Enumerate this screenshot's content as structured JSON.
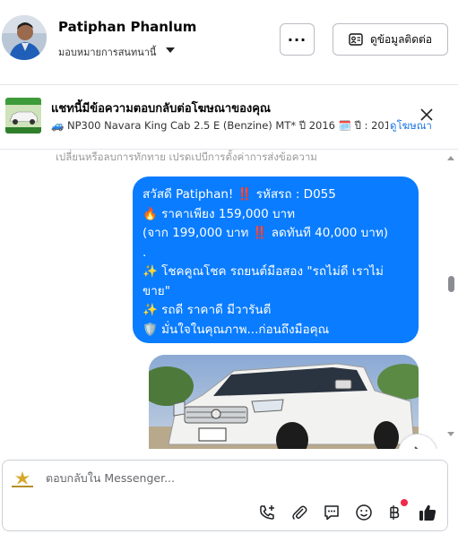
{
  "header": {
    "contact_name": "Patiphan Phanlum",
    "assign_label": "มอบหมายการสนทนานี้",
    "more_label": "···",
    "contact_info_label": "ดูข้อมูลติดต่อ"
  },
  "ad_context": {
    "title": "แชทนี้มีข้อความตอบกลับต่อโฆษณาของคุณ",
    "subtitle": "🚙 NP300 Navara King Cab 2.5 E (Benzine) MT* ปี 2016 🗓️ ปี : 201...",
    "view_ad_label": "ดูโฆษณา"
  },
  "chat": {
    "faded_previous": "เปลี่ยนหรือลบการทักทาย เปรดเปบีการตั้งค่าการส่งข้อความ",
    "message": {
      "line1": "สวัสดี Patiphan! ‼️ รหัสรถ : D055",
      "line2": "🔥 ราคาเพียง 159,000 บาท",
      "line3": "(จาก 199,000 บาท ‼️ ลดทันที 40,000 บาท)",
      "line4": ".",
      "line5": "✨ โชคคูณโชค รถยนต์มือสอง \"รถไม่ดี เราไม่ขาย\"",
      "line6": "✨ รถดี ราคาดี มีวารันตี",
      "line7": "🛡️ มั่นใจในคุณภาพ...ก่อนถึงมือคุณ"
    }
  },
  "composer": {
    "placeholder": "ตอบกลับใน Messenger..."
  },
  "icons": {
    "call": "phone-add-icon",
    "attach": "paperclip-icon",
    "saved_reply": "chat-bubble-icon",
    "emoji": "smiley-icon",
    "payment": "baht-icon",
    "like": "thumbs-up-icon"
  },
  "colors": {
    "bubble": "#0a7cff",
    "link": "#1b74e4",
    "notification": "#f02849"
  }
}
